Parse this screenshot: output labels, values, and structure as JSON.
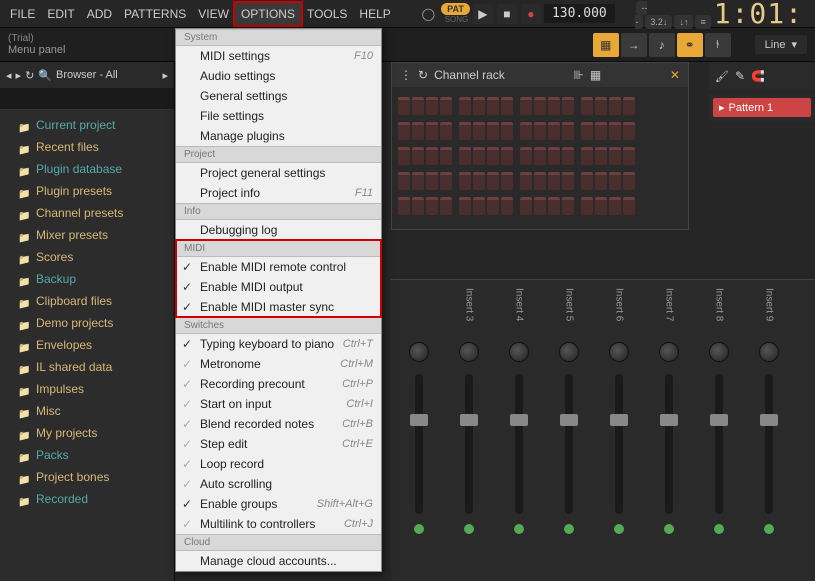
{
  "menubar": {
    "items": [
      "FILE",
      "EDIT",
      "ADD",
      "PATTERNS",
      "VIEW",
      "OPTIONS",
      "TOOLS",
      "HELP"
    ],
    "active_index": 5
  },
  "transport": {
    "pat_label": "PAT",
    "song_label": "SONG",
    "tempo": "130.000",
    "time": "1:01:"
  },
  "small_pills": [
    "---",
    "3.2↓",
    "↓↑",
    "≡"
  ],
  "hint": {
    "line1": "(Trial)",
    "line2": "Menu panel"
  },
  "snap": {
    "mode": "Line"
  },
  "browser": {
    "title": "Browser - All",
    "items": [
      {
        "label": "Current project",
        "cls": "teal"
      },
      {
        "label": "Recent files"
      },
      {
        "label": "Plugin database",
        "cls": "teal"
      },
      {
        "label": "Plugin presets"
      },
      {
        "label": "Channel presets"
      },
      {
        "label": "Mixer presets"
      },
      {
        "label": "Scores"
      },
      {
        "label": "Backup",
        "cls": "teal"
      },
      {
        "label": "Clipboard files"
      },
      {
        "label": "Demo projects"
      },
      {
        "label": "Envelopes"
      },
      {
        "label": "IL shared data"
      },
      {
        "label": "Impulses"
      },
      {
        "label": "Misc"
      },
      {
        "label": "My projects"
      },
      {
        "label": "Packs",
        "cls": "teal"
      },
      {
        "label": "Project bones"
      },
      {
        "label": "Recorded",
        "cls": "teal"
      }
    ]
  },
  "channel_rack": {
    "title": "Channel rack",
    "rows": 5,
    "steps": 16
  },
  "pattern": {
    "name": "Pattern 1"
  },
  "mixer": {
    "tracks": [
      "",
      "Insert 3",
      "Insert 4",
      "Insert 5",
      "Insert 6",
      "Insert 7",
      "Insert 8",
      "Insert 9"
    ]
  },
  "dropdown": {
    "sections": [
      {
        "title": "System",
        "items": [
          {
            "label": "MIDI settings",
            "shortcut": "F10"
          },
          {
            "label": "Audio settings"
          },
          {
            "label": "General settings"
          },
          {
            "label": "File settings"
          },
          {
            "label": "Manage plugins"
          }
        ]
      },
      {
        "title": "Project",
        "items": [
          {
            "label": "Project general settings"
          },
          {
            "label": "Project info",
            "shortcut": "F11"
          }
        ]
      },
      {
        "title": "Info",
        "items": [
          {
            "label": "Debugging log"
          }
        ]
      },
      {
        "title": "MIDI",
        "highlight": true,
        "items": [
          {
            "label": "Enable MIDI remote control",
            "checked": true
          },
          {
            "label": "Enable MIDI output",
            "checked": true
          },
          {
            "label": "Enable MIDI master sync",
            "checked": true
          }
        ]
      },
      {
        "title": "Switches",
        "items": [
          {
            "label": "Typing keyboard to piano",
            "checked": true,
            "shortcut": "Ctrl+T"
          },
          {
            "label": "Metronome",
            "grayed": true,
            "shortcut": "Ctrl+M"
          },
          {
            "label": "Recording precount",
            "grayed": true,
            "shortcut": "Ctrl+P"
          },
          {
            "label": "Start on input",
            "grayed": true,
            "shortcut": "Ctrl+I"
          },
          {
            "label": "Blend recorded notes",
            "grayed": true,
            "shortcut": "Ctrl+B"
          },
          {
            "label": "Step edit",
            "grayed": true,
            "shortcut": "Ctrl+E"
          },
          {
            "label": "Loop record",
            "grayed": true
          },
          {
            "label": "Auto scrolling",
            "grayed": true
          },
          {
            "label": "Enable groups",
            "checked": true,
            "shortcut": "Shift+Alt+G"
          },
          {
            "label": "Multilink to controllers",
            "grayed": true,
            "shortcut": "Ctrl+J"
          }
        ]
      },
      {
        "title": "Cloud",
        "items": [
          {
            "label": "Manage cloud accounts..."
          }
        ]
      }
    ]
  }
}
